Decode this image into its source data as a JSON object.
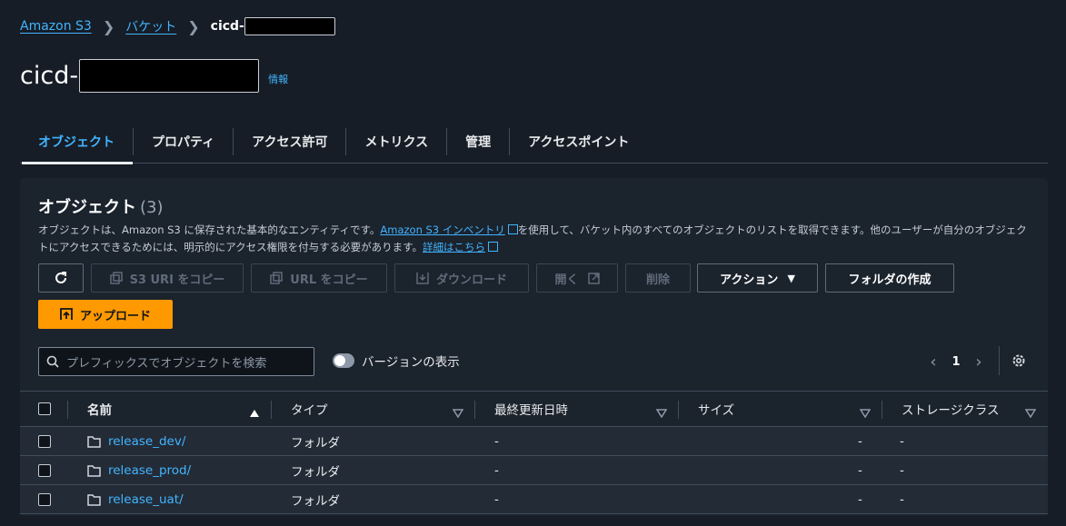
{
  "breadcrumb": {
    "items": [
      "Amazon S3",
      "バケット"
    ],
    "current_prefix": "cicd-"
  },
  "header": {
    "title": "cicd-",
    "info": "情報"
  },
  "tabs": [
    {
      "label": "オブジェクト",
      "active": true
    },
    {
      "label": "プロパティ"
    },
    {
      "label": "アクセス許可"
    },
    {
      "label": "メトリクス"
    },
    {
      "label": "管理"
    },
    {
      "label": "アクセスポイント"
    }
  ],
  "objects": {
    "title": "オブジェクト",
    "count": "(3)",
    "desc_1": "オブジェクトは、Amazon S3 に保存された基本的なエンティティです。",
    "desc_link_1": "Amazon S3 インベントリ",
    "desc_2": "を使用して、バケット内のすべてのオブジェクトのリストを取得できます。他のユーザーが自分のオブジェクトにアクセスできるためには、明示的にアクセス権限を付与する必要があります。",
    "desc_link_2": "詳細はこちら"
  },
  "toolbar": {
    "copy_s3_uri": "S3 URI をコピー",
    "copy_url": "URL をコピー",
    "download": "ダウンロード",
    "open": "開く",
    "delete": "削除",
    "actions": "アクション",
    "create_folder": "フォルダの作成",
    "upload": "アップロード"
  },
  "search": {
    "placeholder": "プレフィックスでオブジェクトを検索"
  },
  "versions": {
    "label": "バージョンの表示",
    "enabled": false
  },
  "pagination": {
    "page": "1"
  },
  "table": {
    "columns": [
      "名前",
      "タイプ",
      "最終更新日時",
      "サイズ",
      "ストレージクラス"
    ],
    "rows": [
      {
        "name": "release_dev/",
        "type": "フォルダ",
        "modified": "-",
        "size": "-",
        "storage": "-"
      },
      {
        "name": "release_prod/",
        "type": "フォルダ",
        "modified": "-",
        "size": "-",
        "storage": "-"
      },
      {
        "name": "release_uat/",
        "type": "フォルダ",
        "modified": "-",
        "size": "-",
        "storage": "-"
      }
    ]
  },
  "colors": {
    "background": "#161d26",
    "panel": "#1b232d",
    "link": "#42b4ff",
    "primary": "#ff9900"
  }
}
